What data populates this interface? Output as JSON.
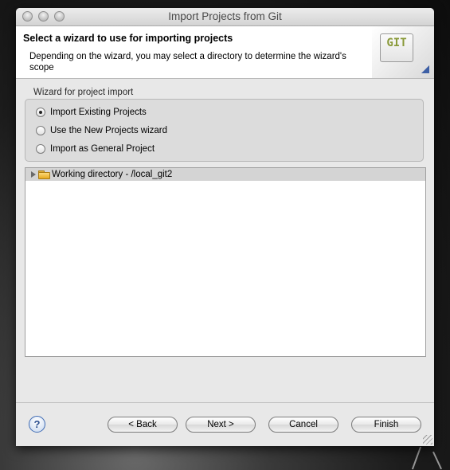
{
  "window": {
    "title": "Import Projects from Git"
  },
  "header": {
    "title": "Select a wizard to use for importing projects",
    "description": "Depending on the wizard, you may select a directory to determine the wizard's scope",
    "logo_text": "GIT"
  },
  "wizard_group": {
    "label": "Wizard for project import",
    "options": [
      {
        "label": "Import Existing Projects",
        "selected": true
      },
      {
        "label": "Use the New Projects wizard",
        "selected": false
      },
      {
        "label": "Import as General Project",
        "selected": false
      }
    ]
  },
  "tree": {
    "items": [
      {
        "label": "Working directory - /local_git2",
        "expanded": false
      }
    ]
  },
  "buttons": {
    "back": "< Back",
    "next": "Next >",
    "cancel": "Cancel",
    "finish": "Finish",
    "help": "?"
  }
}
